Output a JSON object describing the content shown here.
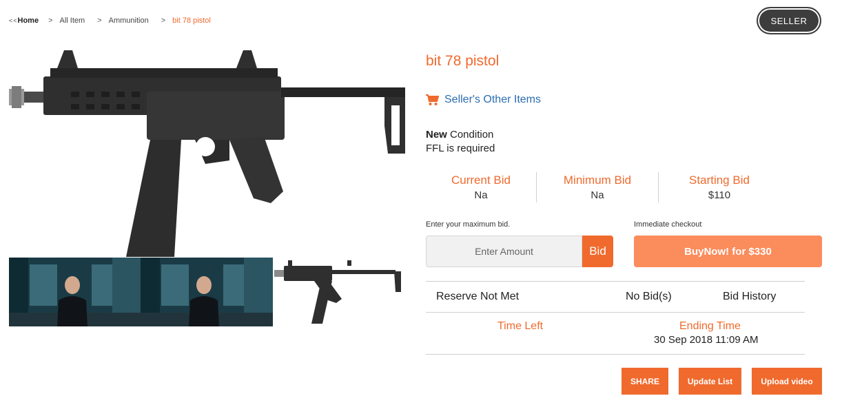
{
  "breadcrumb": {
    "prefix": "<<",
    "home": "Home",
    "separator": ">",
    "items": [
      "All Item",
      "Ammunition",
      "bit 78 pistol"
    ]
  },
  "seller_button": "SELLER",
  "product": {
    "title": "bit 78 pistol",
    "other_items_link": "Seller's Other Items",
    "condition_bold": "New",
    "condition_text": " Condition",
    "ffl_text": "FFL is required"
  },
  "bids": [
    {
      "label": "Current Bid",
      "value": "Na"
    },
    {
      "label": "Minimum Bid",
      "value": "Na"
    },
    {
      "label": "Starting Bid",
      "value": "$110"
    }
  ],
  "bid_form": {
    "max_bid_label": "Enter your maximum bid.",
    "amount_placeholder": "Enter Amount",
    "bid_button": "Bid",
    "checkout_label": "Immediate checkout",
    "buynow_button": "BuyNow! for $330"
  },
  "status": {
    "reserve": "Reserve Not Met",
    "bids": "No Bid(s)",
    "history": "Bid History"
  },
  "timing": {
    "time_left_label": "Time Left",
    "ending_label": "Ending Time",
    "ending_value": "30 Sep 2018 11:09 AM"
  },
  "actions": {
    "share": "SHARE",
    "update": "Update List",
    "upload": "Upload video"
  },
  "colors": {
    "accent": "#f06a2d",
    "buynow": "#fb8c5c",
    "link": "#2a6db0",
    "seller_bg": "#3d3d3d"
  },
  "icons": {
    "cart": "cart-icon"
  }
}
